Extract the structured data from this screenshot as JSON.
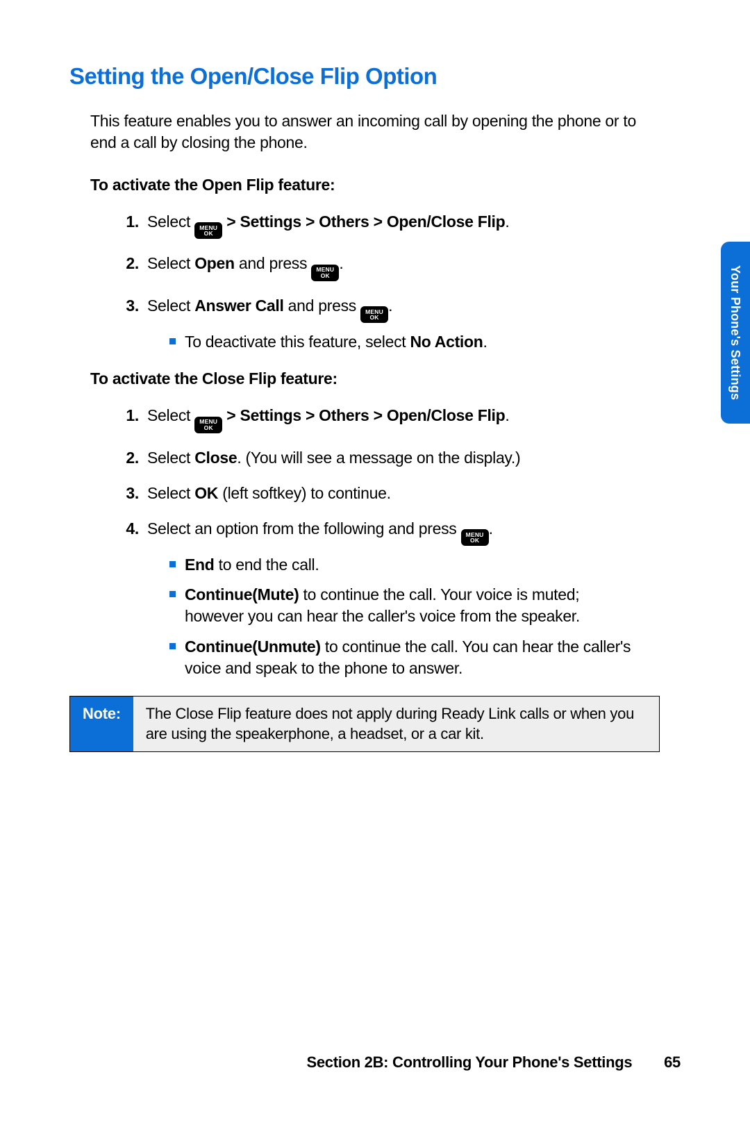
{
  "heading": "Setting the Open/Close Flip Option",
  "intro": "This feature enables you to answer an incoming call by opening the phone or to end a call by closing the phone.",
  "openHead": "To activate the Open Flip feature:",
  "icon": {
    "line1": "MENU",
    "line2": "OK"
  },
  "open": {
    "s1": {
      "a": "Select ",
      "b": " > Settings > Others > Open/Close Flip",
      "c": "."
    },
    "s2": {
      "a": "Select ",
      "b": "Open",
      "c": " and press ",
      "d": "."
    },
    "s3": {
      "a": "Select ",
      "b": "Answer Call",
      "c": " and press ",
      "d": ".",
      "sub": {
        "a": "To deactivate this feature, select ",
        "b": "No Action",
        "c": "."
      }
    }
  },
  "closeHead": "To activate the Close Flip feature:",
  "close": {
    "s1": {
      "a": "Select ",
      "b": " > Settings > Others > Open/Close Flip",
      "c": "."
    },
    "s2": {
      "a": "Select ",
      "b": "Close",
      "c": ". (You will see a message on the display.)"
    },
    "s3": {
      "a": "Select ",
      "b": "OK",
      "c": " (left softkey) to continue."
    },
    "s4": {
      "a": "Select an option from the following and press ",
      "b": ".",
      "opts": {
        "o1": {
          "b": "End",
          "t": " to end the call."
        },
        "o2": {
          "b": "Continue(Mute)",
          "t": " to continue the call. Your voice is muted; however you can hear the caller's voice from the speaker."
        },
        "o3": {
          "b": "Continue(Unmute)",
          "t": " to continue the call. You can hear the caller's voice and speak to the phone to answer."
        }
      }
    }
  },
  "note": {
    "label": "Note:",
    "text": "The Close Flip feature does not apply during Ready Link calls or when you are using the speakerphone, a headset, or a car kit."
  },
  "sideTab": "Your Phone's Settings",
  "footer": {
    "section": "Section 2B: Controlling Your Phone's Settings",
    "page": "65"
  },
  "nums": {
    "n1": "1.",
    "n2": "2.",
    "n3": "3.",
    "n4": "4."
  }
}
